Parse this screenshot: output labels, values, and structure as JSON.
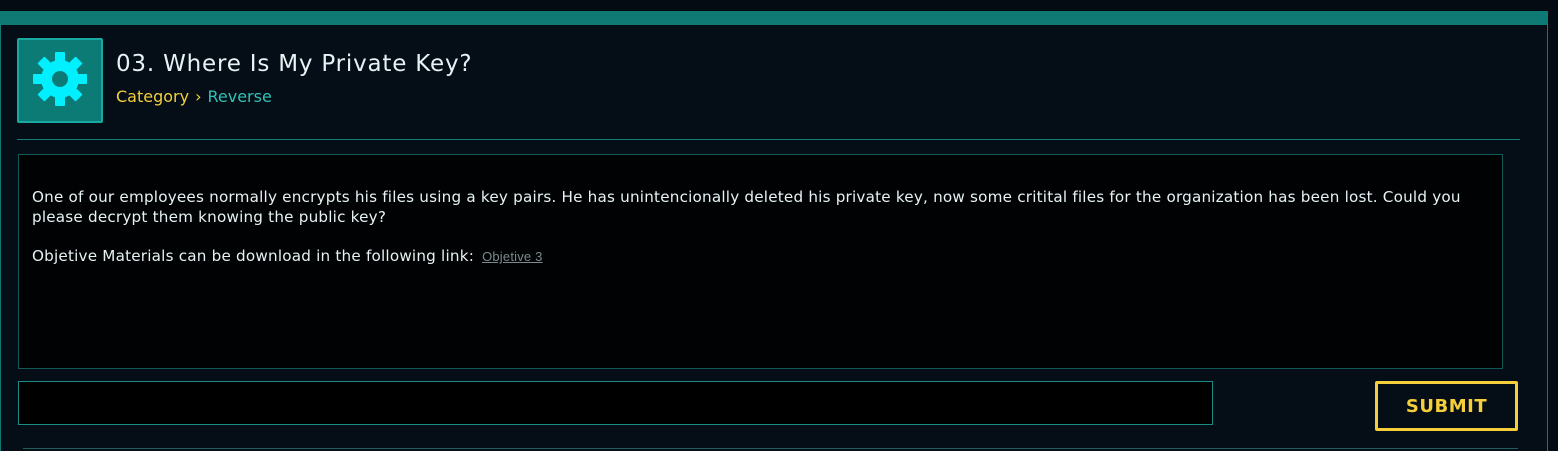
{
  "challenge": {
    "title": "03. Where Is My Private Key?",
    "icon": "gear-icon",
    "breadcrumb": {
      "category_label": "Category",
      "separator": "›",
      "category_value": "Reverse"
    }
  },
  "description": {
    "paragraph_1": "One of our employees normally encrypts his files using a key pairs. He has unintencionally deleted his private key, now some critital files for the organization has been lost. Could you please decrypt them knowing the public key?",
    "paragraph_2": "Objetive Materials can be download in the following link:",
    "link_text": "Objetive 3"
  },
  "form": {
    "flag_input_value": "",
    "submit_label": "SUBMIT"
  },
  "colors": {
    "accent_teal": "#0f7a73",
    "accent_yellow": "#f4cf3a",
    "text": "#e6f2f4",
    "background": "#050d16"
  }
}
